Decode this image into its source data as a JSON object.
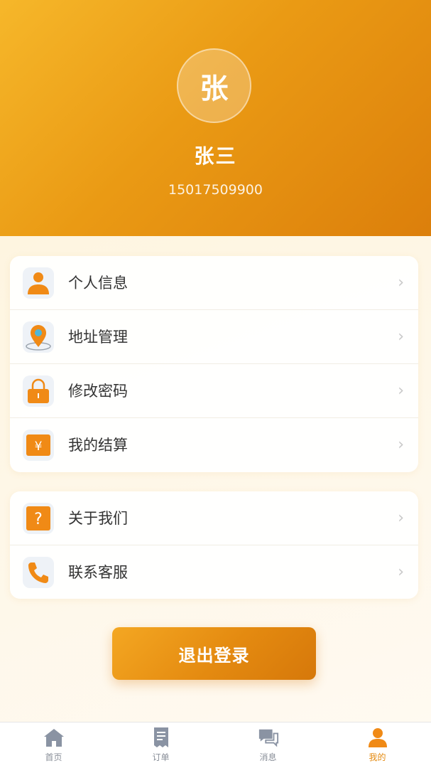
{
  "profile": {
    "avatar_char": "张",
    "name": "张三",
    "phone": "15017509900"
  },
  "menu_group_1": [
    {
      "label": "个人信息",
      "icon": "user-icon"
    },
    {
      "label": "地址管理",
      "icon": "location-pin-icon"
    },
    {
      "label": "修改密码",
      "icon": "lock-icon"
    },
    {
      "label": "我的结算",
      "icon": "yen-icon"
    }
  ],
  "menu_group_2": [
    {
      "label": "关于我们",
      "icon": "question-icon"
    },
    {
      "label": "联系客服",
      "icon": "phone-icon"
    }
  ],
  "arrow": "›",
  "logout_label": "退出登录",
  "tabs": [
    {
      "label": "首页",
      "icon": "home-icon",
      "active": false
    },
    {
      "label": "订单",
      "icon": "order-icon",
      "active": false
    },
    {
      "label": "消息",
      "icon": "message-icon",
      "active": false
    },
    {
      "label": "我的",
      "icon": "profile-icon",
      "active": true
    }
  ],
  "colors": {
    "accent": "#e48a10",
    "header_start": "#f6b72a",
    "header_end": "#dc7f0b",
    "icon_orange": "#f08a16",
    "tab_inactive": "#8a8f99"
  }
}
